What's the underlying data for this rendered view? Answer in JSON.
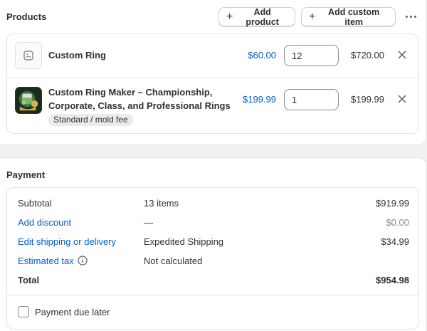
{
  "products": {
    "title": "Products",
    "add_product_label": "Add product",
    "add_custom_item_label": "Add custom item",
    "items": [
      {
        "name": "Custom Ring",
        "variant": "",
        "price": "$60.00",
        "quantity": "12",
        "total": "$720.00",
        "thumbnail_icon": "image-placeholder-icon"
      },
      {
        "name": "Custom Ring Maker – Championship, Corporate, Class, and Professional Rings",
        "variant": "Standard / mold fee",
        "price": "$199.99",
        "quantity": "1",
        "total": "$199.99",
        "thumbnail_icon": "product-photo"
      }
    ]
  },
  "payment": {
    "title": "Payment",
    "rows": [
      {
        "label": "Subtotal",
        "detail": "13 items",
        "amount": "$919.99"
      },
      {
        "label": "Add discount",
        "detail": "—",
        "amount": "$0.00"
      },
      {
        "label": "Edit shipping or delivery",
        "detail": "Expedited Shipping",
        "amount": "$34.99"
      },
      {
        "label": "Estimated tax",
        "detail": "Not calculated",
        "amount": ""
      },
      {
        "label": "Total",
        "detail": "",
        "amount": "$954.98"
      }
    ],
    "payment_due_later_label": "Payment due later",
    "payment_due_later_checked": false
  },
  "colors": {
    "link": "#005bd3",
    "background": "#f1f1f1",
    "card": "#ffffff"
  }
}
